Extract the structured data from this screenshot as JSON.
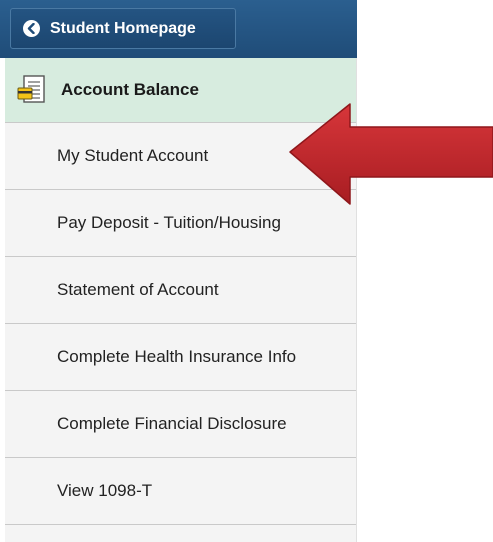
{
  "nav": {
    "back_label": "Student Homepage"
  },
  "sidebar": {
    "header_label": "Account Balance",
    "items": [
      {
        "label": "My Student Account"
      },
      {
        "label": "Pay Deposit - Tuition/Housing"
      },
      {
        "label": "Statement of Account"
      },
      {
        "label": "Complete Health Insurance Info"
      },
      {
        "label": "Complete Financial Disclosure"
      },
      {
        "label": "View 1098-T"
      }
    ]
  },
  "colors": {
    "nav_bar": "#1f4c78",
    "header_bg": "#d7ecdf",
    "menu_bg": "#f4f4f4",
    "arrow": "#c0272d"
  },
  "icons": {
    "back": "chevron-left-icon",
    "header": "document-card-icon",
    "annotation": "red-arrow-pointer"
  }
}
